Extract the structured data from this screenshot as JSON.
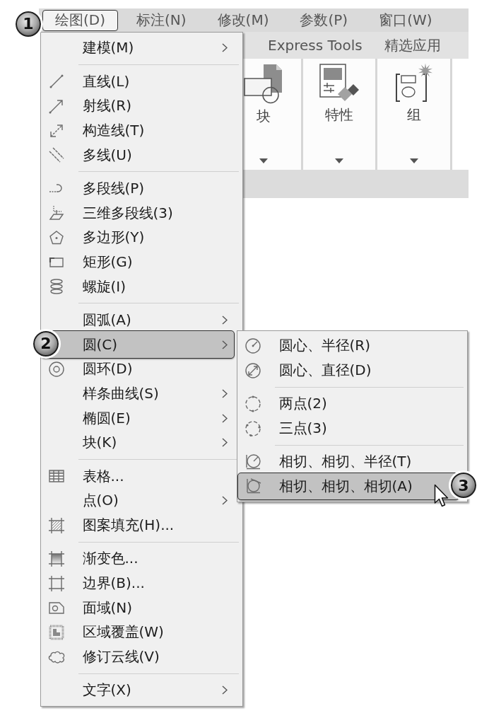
{
  "menu_bar": {
    "items": [
      {
        "label": "绘图(D)",
        "selected": true,
        "callout": "1"
      },
      {
        "label": "标注(N)",
        "selected": false
      },
      {
        "label": "修改(M)",
        "selected": false
      },
      {
        "label": "参数(P)",
        "selected": false
      },
      {
        "label": "窗口(W)",
        "selected": false
      }
    ]
  },
  "ribbon": {
    "tabs": [
      {
        "label": "Express Tools",
        "selected": false
      },
      {
        "label": "精选应用",
        "selected": false
      }
    ],
    "panels": [
      {
        "label": "块"
      },
      {
        "label": "特性"
      },
      {
        "label": "组"
      }
    ]
  },
  "draw_menu": {
    "sections": [
      {
        "items": [
          {
            "label": "建模(M)",
            "has_submenu": true,
            "selected": false
          }
        ]
      },
      {
        "items": [
          {
            "label": "直线(L)",
            "has_submenu": false,
            "selected": false
          },
          {
            "label": "射线(R)",
            "has_submenu": false,
            "selected": false
          },
          {
            "label": "构造线(T)",
            "has_submenu": false,
            "selected": false
          },
          {
            "label": "多线(U)",
            "has_submenu": false,
            "selected": false
          }
        ]
      },
      {
        "items": [
          {
            "label": "多段线(P)",
            "has_submenu": false,
            "selected": false
          },
          {
            "label": "三维多段线(3)",
            "has_submenu": false,
            "selected": false
          },
          {
            "label": "多边形(Y)",
            "has_submenu": false,
            "selected": false
          },
          {
            "label": "矩形(G)",
            "has_submenu": false,
            "selected": false
          },
          {
            "label": "螺旋(I)",
            "has_submenu": false,
            "selected": false
          }
        ]
      },
      {
        "items": [
          {
            "label": "圆弧(A)",
            "has_submenu": true,
            "selected": false
          },
          {
            "label": "圆(C)",
            "has_submenu": true,
            "selected": true,
            "callout": "2"
          },
          {
            "label": "圆环(D)",
            "has_submenu": false,
            "selected": false
          },
          {
            "label": "样条曲线(S)",
            "has_submenu": true,
            "selected": false
          },
          {
            "label": "椭圆(E)",
            "has_submenu": true,
            "selected": false
          },
          {
            "label": "块(K)",
            "has_submenu": true,
            "selected": false
          }
        ]
      },
      {
        "items": [
          {
            "label": "表格...",
            "has_submenu": false,
            "selected": false
          },
          {
            "label": "点(O)",
            "has_submenu": true,
            "selected": false
          },
          {
            "label": "图案填充(H)...",
            "has_submenu": false,
            "selected": false
          }
        ]
      },
      {
        "items": [
          {
            "label": "渐变色...",
            "has_submenu": false,
            "selected": false
          },
          {
            "label": "边界(B)...",
            "has_submenu": false,
            "selected": false
          },
          {
            "label": "面域(N)",
            "has_submenu": false,
            "selected": false
          },
          {
            "label": "区域覆盖(W)",
            "has_submenu": false,
            "selected": false
          },
          {
            "label": "修订云线(V)",
            "has_submenu": false,
            "selected": false
          }
        ]
      },
      {
        "items": [
          {
            "label": "文字(X)",
            "has_submenu": true,
            "selected": false
          }
        ]
      }
    ]
  },
  "circle_submenu": {
    "sections": [
      {
        "items": [
          {
            "label": "圆心、半径(R)",
            "has_submenu": false,
            "selected": false
          },
          {
            "label": "圆心、直径(D)",
            "has_submenu": false,
            "selected": false
          }
        ]
      },
      {
        "items": [
          {
            "label": "两点(2)",
            "has_submenu": false,
            "selected": false
          },
          {
            "label": "三点(3)",
            "has_submenu": false,
            "selected": false
          }
        ]
      },
      {
        "items": [
          {
            "label": "相切、相切、半径(T)",
            "has_submenu": false,
            "selected": false
          },
          {
            "label": "相切、相切、相切(A)",
            "has_submenu": false,
            "selected": true,
            "callout": "3"
          }
        ]
      }
    ]
  }
}
